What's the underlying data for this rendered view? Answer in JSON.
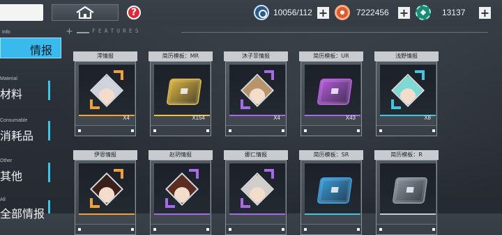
{
  "resources": {
    "stamina": "10056/112",
    "coins": "7222456",
    "gems": "13137"
  },
  "features_label": "FEATURES",
  "sidebar": {
    "active": {
      "en": "Info",
      "cn": "情报"
    },
    "items": [
      {
        "en": "Material",
        "cn": "材料"
      },
      {
        "en": "Consumable",
        "cn": "消耗品"
      },
      {
        "en": "Other",
        "cn": "其他"
      },
      {
        "en": "All",
        "cn": "全部情报"
      }
    ]
  },
  "cards_row1": [
    {
      "title": "澪情报",
      "count": "X4",
      "rarity": "#f0a236",
      "kind": "portrait",
      "hair": "#cfd4dc"
    },
    {
      "title": "简历模板：MR",
      "count": "X154",
      "rarity": "#f0c340",
      "kind": "chip",
      "chip": "#d8b240"
    },
    {
      "title": "沐子菲情报",
      "count": "X4",
      "rarity": "#a86ae8",
      "kind": "portrait",
      "hair": "#b8946a"
    },
    {
      "title": "简历模板：UR",
      "count": "X43",
      "rarity": "#a86ae8",
      "kind": "chip",
      "chip": "#b35ad8"
    },
    {
      "title": "浅野情报",
      "count": "X8",
      "rarity": "#40c6de",
      "kind": "portrait",
      "hair": "#7ed8d4"
    }
  ],
  "cards_row2": [
    {
      "title": "伊恩情报",
      "count": "",
      "rarity": "#f0a236",
      "kind": "portrait",
      "hair": "#3a2018"
    },
    {
      "title": "赵玥情报",
      "count": "",
      "rarity": "#a86ae8",
      "kind": "portrait",
      "hair": "#5a2c22"
    },
    {
      "title": "娜仁情报",
      "count": "",
      "rarity": "#a86ae8",
      "kind": "portrait",
      "hair": "#d0cec8"
    },
    {
      "title": "简历模板：SR",
      "count": "",
      "rarity": "#40c6de",
      "kind": "chip",
      "chip": "#3a9ad8"
    },
    {
      "title": "简历模板：R",
      "count": "",
      "rarity": "#c8ccd0",
      "kind": "chip",
      "chip": "#8a929c"
    }
  ]
}
